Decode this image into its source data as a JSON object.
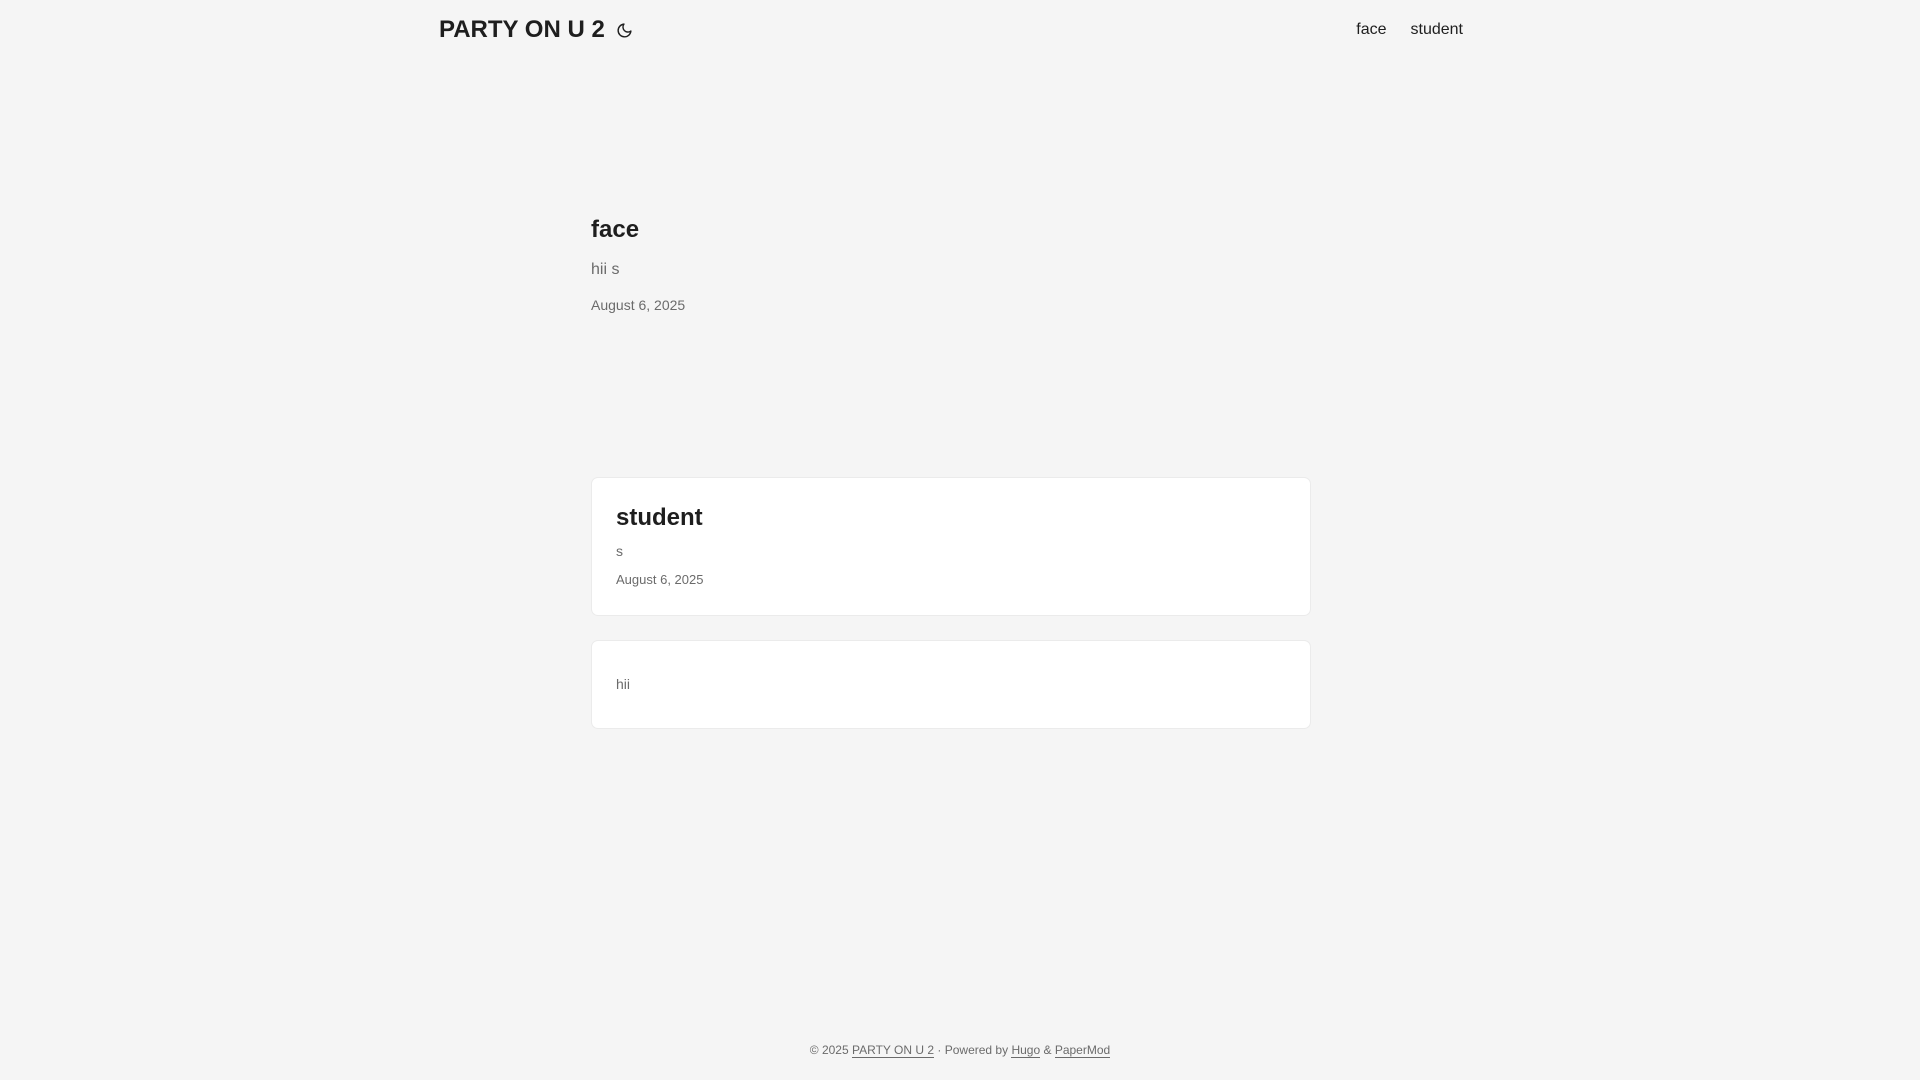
{
  "header": {
    "logo": "PARTY ON U 2",
    "theme_toggle_icon": "moon-icon",
    "menu": [
      {
        "label": "face"
      },
      {
        "label": "student"
      }
    ]
  },
  "first_entry": {
    "title": "face",
    "summary": "hii s",
    "date": "August 6, 2025"
  },
  "posts": [
    {
      "title": "student",
      "summary": "s",
      "date": "August 6, 2025"
    },
    {
      "title": "",
      "summary": "hii",
      "date": ""
    }
  ],
  "footer": {
    "copyright": "© 2025",
    "site_link": "PARTY ON U 2",
    "separator": "·",
    "powered_by": "Powered by",
    "hugo_link": "Hugo",
    "amp": "&",
    "theme_link": "PaperMod"
  },
  "colors": {
    "background": "#f5f5f5",
    "card": "#ffffff",
    "text": "#1e1e1e",
    "muted": "#6b6b6b",
    "border": "#ebebeb"
  }
}
